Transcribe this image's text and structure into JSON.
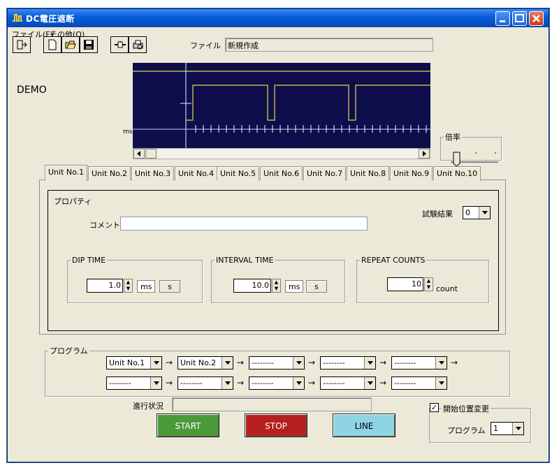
{
  "window": {
    "title": "DC電圧遮断",
    "icon": "waveform-icon",
    "controls": [
      "minimize-icon",
      "maximize-icon",
      "close-icon"
    ]
  },
  "menu": [
    "ファイル(F)",
    "その他(O)"
  ],
  "toolbar": {
    "buttons": [
      "exit-icon",
      "new-file-icon",
      "open-folder-icon",
      "save-icon",
      "connect-icon",
      "print-preview-icon"
    ],
    "file_label": "ファイル",
    "file_value": "新規作成"
  },
  "demo_label": "DEMO",
  "waveform": {
    "ms_label": "ms"
  },
  "zoom": {
    "label": "倍率"
  },
  "tabs": [
    "Unit No.1",
    "Unit No.2",
    "Unit No.3",
    "Unit No.4",
    "Unit No.5",
    "Unit No.6",
    "Unit No.7",
    "Unit No.8",
    "Unit No.9",
    "Unit No.10"
  ],
  "active_tab": "Unit No.1",
  "properties": {
    "legend": "プロパティ",
    "test_result_label": "試験結果",
    "test_result_value": "0",
    "comment_label": "コメント",
    "comment_value": "",
    "dip_time": {
      "legend": "DIP TIME",
      "value": "1.0",
      "unit_ms": "ms",
      "unit_s": "s"
    },
    "interval_time": {
      "legend": "INTERVAL TIME",
      "value": "10.0",
      "unit_ms": "ms",
      "unit_s": "s"
    },
    "repeat_counts": {
      "legend": "REPEAT COUNTS",
      "value": "10",
      "unit": "count"
    }
  },
  "program": {
    "legend": "プログラム",
    "row1": [
      "Unit No.1",
      "Unit No.2",
      "--------",
      "--------",
      "--------"
    ],
    "row2": [
      "--------",
      "--------",
      "--------",
      "--------",
      "--------"
    ],
    "arrow": "→"
  },
  "progress": {
    "label": "進行状況",
    "value": ""
  },
  "start_position": {
    "checkbox_label": "開始位置変更",
    "checked": true,
    "program_label": "プログラム",
    "program_value": "1"
  },
  "buttons": {
    "start": "START",
    "stop": "STOP",
    "line": "LINE"
  },
  "colors": {
    "start": "#4a9a3c",
    "stop": "#b51f1f",
    "line": "#8fd4e4",
    "waveform_bg": "#0e0e4c",
    "waveform_line": "#e8d84a"
  }
}
